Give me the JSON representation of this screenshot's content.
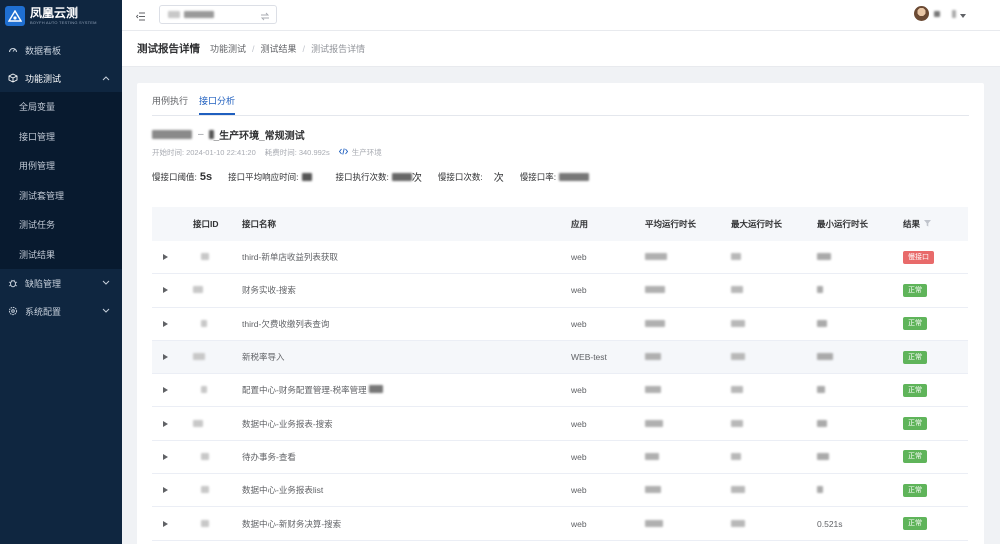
{
  "brand": {
    "name": "凤凰云测",
    "subtitle": "BOYFH AUTO TESTING SYSTEM"
  },
  "sidebar": {
    "items": [
      {
        "label": "数据看板",
        "icon": "dashboard-icon"
      },
      {
        "label": "功能测试",
        "icon": "cube-icon",
        "open": true,
        "children": [
          "全局变量",
          "接口管理",
          "用例管理",
          "测试套管理",
          "测试任务",
          "测试结果"
        ]
      },
      {
        "label": "缺陷管理",
        "icon": "bug-icon"
      },
      {
        "label": "系统配置",
        "icon": "gear-icon"
      }
    ]
  },
  "header": {
    "menu_icon": "menu-fold-icon"
  },
  "page": {
    "title": "测试报告详情",
    "breadcrumb": [
      "功能测试",
      "测试结果",
      "测试报告详情"
    ]
  },
  "tabs": [
    "用例执行",
    "接口分析"
  ],
  "active_tab": 1,
  "report": {
    "title_suffix": "_生产环境_常规测试",
    "start_time_label": "开始时间:",
    "start_time": "2024-01-10 22:41:20",
    "duration_label": "耗费时间:",
    "duration": "340.992s",
    "env": "生产环境"
  },
  "stats": {
    "slow_threshold_label": "慢接口阈值:",
    "slow_threshold": "5s",
    "avg_label": "接口平均响应时间:",
    "exec_count_label": "接口执行次数:",
    "exec_count_unit": "次",
    "slow_count_label": "慢接口次数:",
    "slow_count_unit": "次",
    "slow_rate_label": "慢接口率:"
  },
  "table": {
    "columns": [
      "接口ID",
      "接口名称",
      "应用",
      "平均运行时长",
      "最大运行时长",
      "最小运行时长",
      "结果"
    ],
    "rows": [
      {
        "name": "third-新单店收益列表获取",
        "app": "web",
        "min": "",
        "result": "慢接口",
        "status": "slow"
      },
      {
        "name": "财务实收-搜索",
        "app": "web",
        "min": "",
        "result": "正常",
        "status": "ok"
      },
      {
        "name": "third-欠费收缴列表查询",
        "app": "web",
        "min": "",
        "result": "正常",
        "status": "ok"
      },
      {
        "name": "新税率导入",
        "app": "WEB-test",
        "min": "",
        "result": "正常",
        "status": "ok"
      },
      {
        "name": "配置中心-财务配置管理-税率管理",
        "app": "web",
        "min": "",
        "result": "正常",
        "status": "ok"
      },
      {
        "name": "数据中心-业务报表-搜索",
        "app": "web",
        "min": "",
        "result": "正常",
        "status": "ok"
      },
      {
        "name": "待办事务-查看",
        "app": "web",
        "min": "",
        "result": "正常",
        "status": "ok"
      },
      {
        "name": "数据中心-业务报表list",
        "app": "web",
        "min": "",
        "result": "正常",
        "status": "ok"
      },
      {
        "name": "数据中心-新财务决算-搜索",
        "app": "web",
        "min": "0.521s",
        "result": "正常",
        "status": "ok"
      }
    ]
  },
  "colors": {
    "sidebar_bg": "#0f2640",
    "accent": "#1f5fbf",
    "ok": "#5fb45a",
    "slow": "#e86a6a"
  }
}
